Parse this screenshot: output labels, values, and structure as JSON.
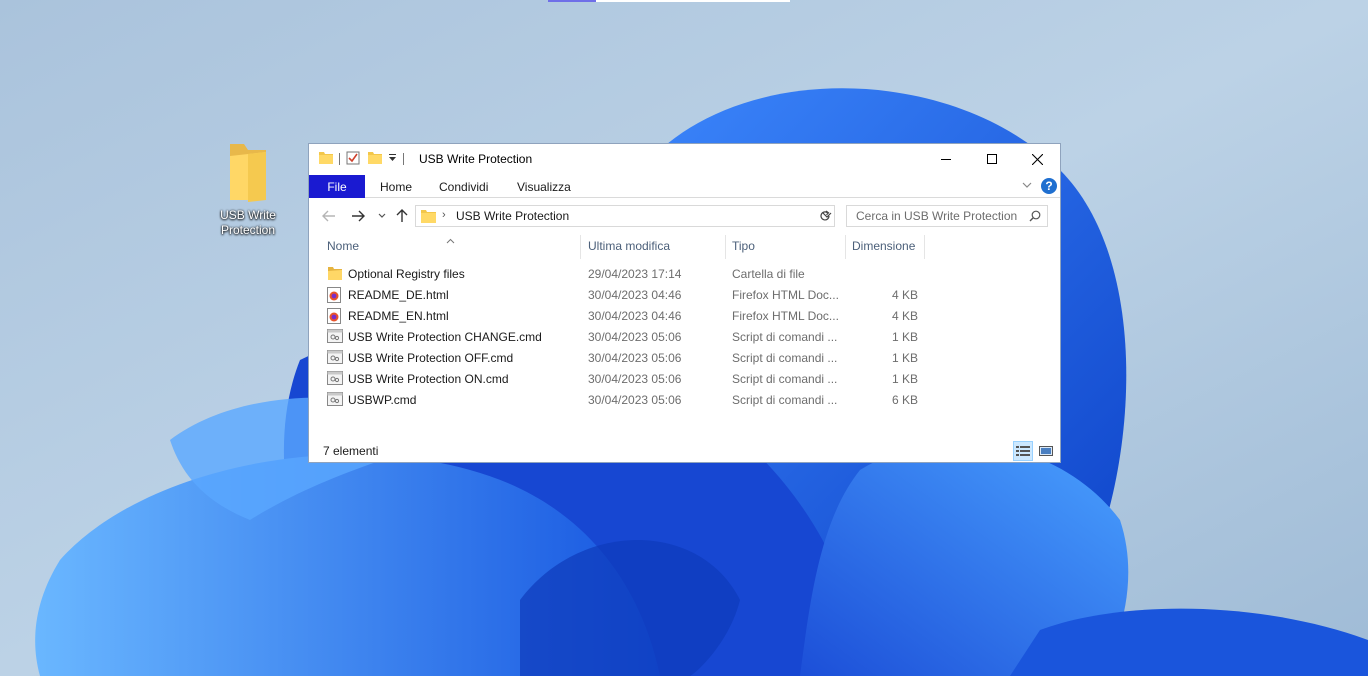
{
  "desktop": {
    "icon_label": "USB Write Protection",
    "colors": {
      "wallpaper_base": "#b9cde0",
      "bloom": "#1d5ce8"
    }
  },
  "window": {
    "title": "USB Write Protection",
    "controls": {
      "minimize": "minimize-icon",
      "maximize": "maximize-icon",
      "close": "close-icon"
    }
  },
  "ribbon": {
    "tabs": [
      "File",
      "Home",
      "Condividi",
      "Visualizza"
    ],
    "accent": "#1a1ad1"
  },
  "navigation": {
    "address": "USB Write Protection",
    "search_placeholder": "Cerca in USB Write Protection"
  },
  "columns": {
    "name": "Nome",
    "modified": "Ultima modifica",
    "type": "Tipo",
    "size": "Dimensione"
  },
  "files": [
    {
      "name": "Optional Registry files",
      "modified": "29/04/2023 17:14",
      "type": "Cartella di file",
      "size": "",
      "icon": "folder-icon"
    },
    {
      "name": "README_DE.html",
      "modified": "30/04/2023 04:46",
      "type": "Firefox HTML Doc...",
      "size": "4 KB",
      "icon": "firefox-html-icon"
    },
    {
      "name": "README_EN.html",
      "modified": "30/04/2023 04:46",
      "type": "Firefox HTML Doc...",
      "size": "4 KB",
      "icon": "firefox-html-icon"
    },
    {
      "name": "USB Write Protection CHANGE.cmd",
      "modified": "30/04/2023 05:06",
      "type": "Script di comandi ...",
      "size": "1 KB",
      "icon": "cmd-script-icon"
    },
    {
      "name": "USB Write Protection OFF.cmd",
      "modified": "30/04/2023 05:06",
      "type": "Script di comandi ...",
      "size": "1 KB",
      "icon": "cmd-script-icon"
    },
    {
      "name": "USB Write Protection ON.cmd",
      "modified": "30/04/2023 05:06",
      "type": "Script di comandi ...",
      "size": "1 KB",
      "icon": "cmd-script-icon"
    },
    {
      "name": "USBWP.cmd",
      "modified": "30/04/2023 05:06",
      "type": "Script di comandi ...",
      "size": "6 KB",
      "icon": "cmd-script-icon"
    }
  ],
  "status": {
    "item_count": "7 elementi"
  }
}
